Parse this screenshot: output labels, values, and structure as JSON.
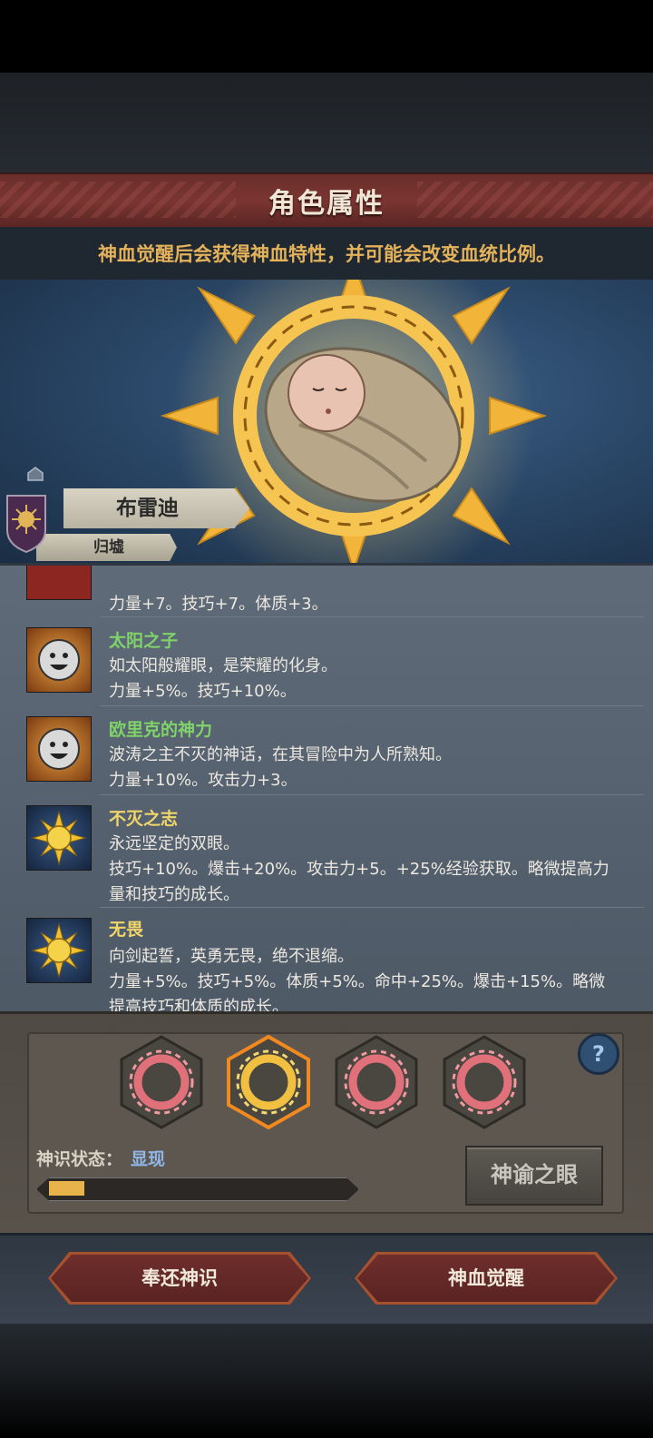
{
  "header": {
    "title": "角色属性",
    "subtitle": "神血觉醒后会获得神血特性，并可能会改变血统比例。"
  },
  "character": {
    "name": "布雷迪",
    "house": "归墟"
  },
  "traits": [
    {
      "name": "",
      "name_color": "#e6c266",
      "icon": "partial-red-icon",
      "lines": [
        "力量+7。技巧+7。体质+3。"
      ]
    },
    {
      "name": "太阳之子",
      "name_color": "#7fd36a",
      "icon": "smiley-icon",
      "lines": [
        "如太阳般耀眼，是荣耀的化身。",
        "力量+5%。技巧+10%。"
      ]
    },
    {
      "name": "欧里克的神力",
      "name_color": "#7fd36a",
      "icon": "smiley-icon",
      "lines": [
        "波涛之主不灭的神话，在其冒险中为人所熟知。",
        "力量+10%。攻击力+3。"
      ]
    },
    {
      "name": "不灭之志",
      "name_color": "#f0d56a",
      "icon": "golden-sun-icon",
      "lines": [
        "永远坚定的双眼。",
        "技巧+10%。爆击+20%。攻击力+5。+25%经验获取。略微提高力",
        "量和技巧的成长。"
      ]
    },
    {
      "name": "无畏",
      "name_color": "#f0d56a",
      "icon": "golden-sun-icon",
      "lines": [
        "向剑起誓，英勇无畏，绝不退缩。",
        "力量+5%。技巧+5%。体质+5%。命中+25%。爆击+15%。略微",
        "提高技巧和体质的成长。"
      ]
    }
  ],
  "divine": {
    "slots": [
      {
        "icon": "red-sunburst-icon",
        "selected": false
      },
      {
        "icon": "golden-sunburst-icon",
        "selected": true
      },
      {
        "icon": "red-sunburst-icon",
        "selected": false
      },
      {
        "icon": "red-sunburst-icon",
        "selected": false
      }
    ],
    "status_label": "神识状态：",
    "status_value": "显现",
    "progress": 0.12,
    "oracle_button": "神谕之眼",
    "help_symbol": "?"
  },
  "buttons": {
    "return_label": "奉还神识",
    "awaken_label": "神血觉醒"
  }
}
